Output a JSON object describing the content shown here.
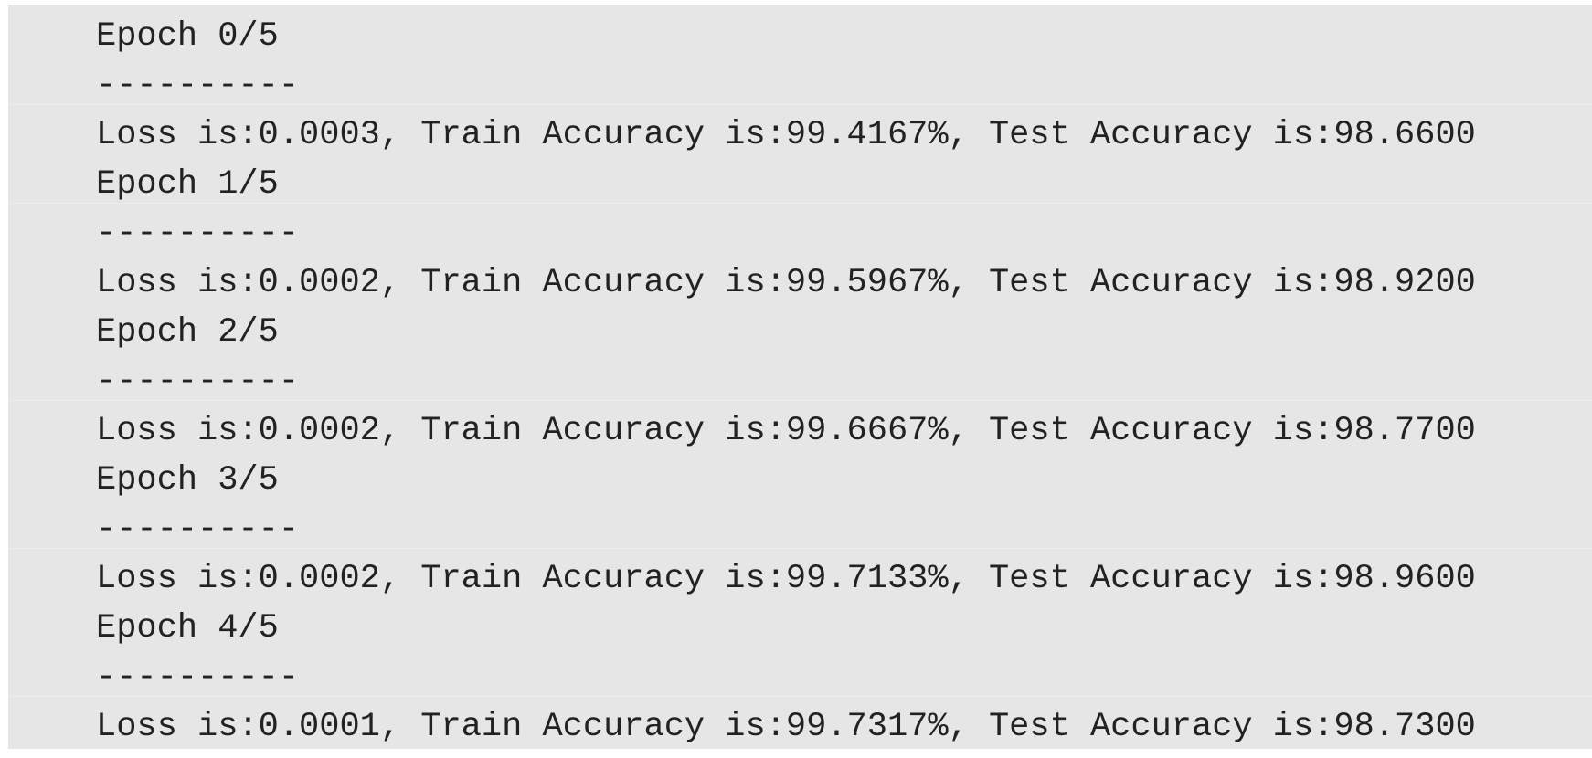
{
  "console": {
    "epochs": [
      {
        "header": "Epoch 0/5",
        "separator": "----------",
        "result": "Loss is:0.0003, Train Accuracy is:99.4167%, Test Accuracy is:98.6600"
      },
      {
        "header": "Epoch 1/5",
        "separator": "----------",
        "result": "Loss is:0.0002, Train Accuracy is:99.5967%, Test Accuracy is:98.9200"
      },
      {
        "header": "Epoch 2/5",
        "separator": "----------",
        "result": "Loss is:0.0002, Train Accuracy is:99.6667%, Test Accuracy is:98.7700"
      },
      {
        "header": "Epoch 3/5",
        "separator": "----------",
        "result": "Loss is:0.0002, Train Accuracy is:99.7133%, Test Accuracy is:98.9600"
      },
      {
        "header": "Epoch 4/5",
        "separator": "----------",
        "result": "Loss is:0.0001, Train Accuracy is:99.7317%, Test Accuracy is:98.7300"
      }
    ]
  }
}
